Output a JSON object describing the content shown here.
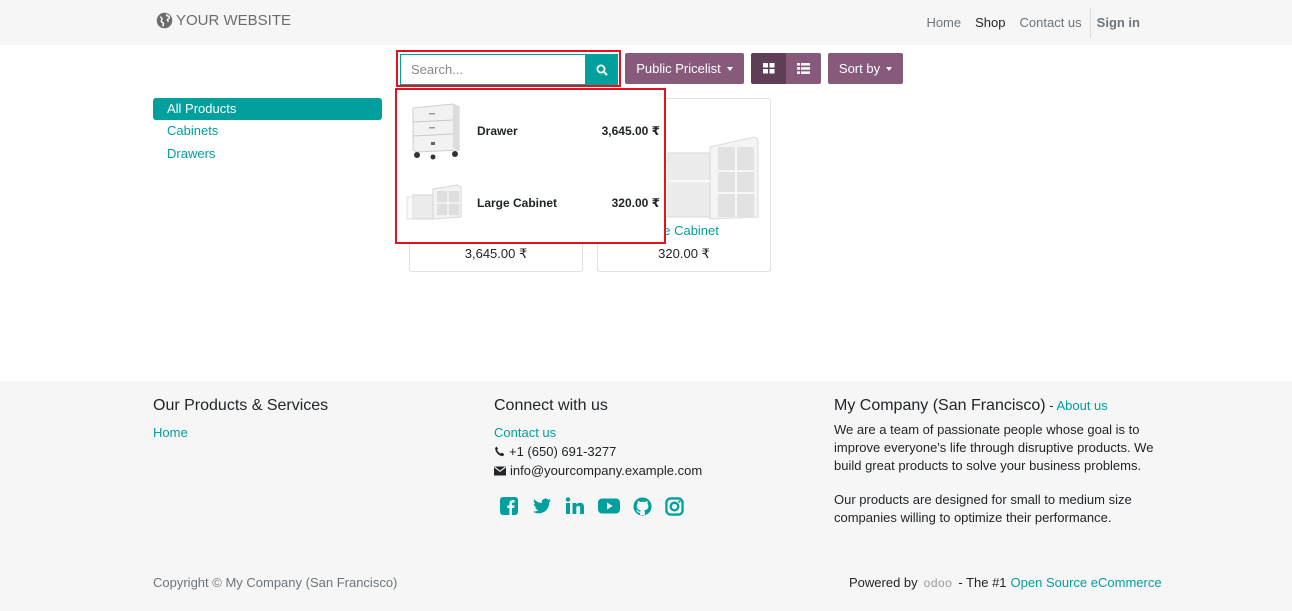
{
  "brand": {
    "logo_text": "YOUR WEBSITE",
    "icon": "globe-icon",
    "accent": "#01a09d",
    "primary": "#875a7b"
  },
  "nav": {
    "items": [
      "Home",
      "Shop",
      "Contact us"
    ],
    "active": "Shop",
    "signin": "Sign in"
  },
  "toolbar": {
    "search_placeholder": "Search...",
    "pricelist_label": "Public Pricelist",
    "sortby_label": "Sort by",
    "grid_icon": "grid-icon",
    "list_icon": "list-icon"
  },
  "sidebar": {
    "all_label": "All Products",
    "categories": [
      "Cabinets",
      "Drawers"
    ]
  },
  "products": [
    {
      "name": "Drawer",
      "price": "3,645.00 ₹"
    },
    {
      "name": "Large Cabinet",
      "price": "320.00 ₹"
    }
  ],
  "card_labels": {
    "visible_name_2": "ge Cabinet"
  },
  "autocomplete": [
    {
      "name": "Drawer",
      "price": "3,645.00 ₹"
    },
    {
      "name": "Large Cabinet",
      "price": "320.00 ₹"
    }
  ],
  "footer": {
    "col1": {
      "title": "Our Products & Services",
      "link": "Home"
    },
    "col2": {
      "title": "Connect with us",
      "link": "Contact us",
      "phone": "+1 (650) 691-3277",
      "email": "info@yourcompany.example.com"
    },
    "col3": {
      "title": "My Company (San Francisco)",
      "title_sep": " - ",
      "about": "About us",
      "p1": "We are a team of passionate people whose goal is to improve everyone's life through disruptive products. We build great products to solve your business problems.",
      "p2": "Our products are designed for small to medium size companies willing to optimize their performance."
    },
    "copyright": "Copyright © My Company (San Francisco)",
    "powered_by": "Powered by",
    "odoo": "odoo",
    "tagline": " - The #1 ",
    "ecommerce_link": "Open Source eCommerce"
  }
}
